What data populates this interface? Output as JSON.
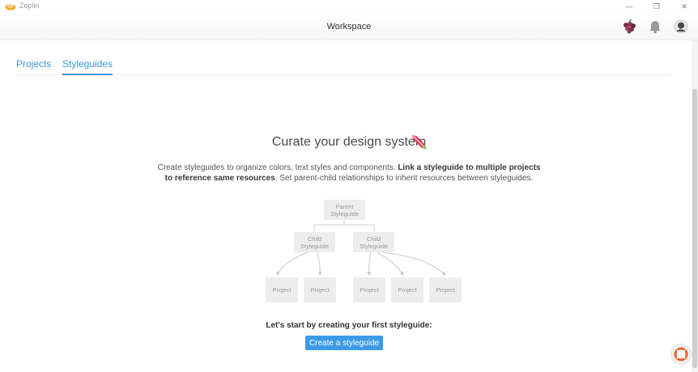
{
  "window": {
    "app_title": "Zeplin",
    "controls": {
      "minimize": "—",
      "restore": "❐",
      "close": "✕"
    }
  },
  "header": {
    "title": "Workspace",
    "icons": [
      "avatar-grapes-icon",
      "notification-bell-icon",
      "user-avatar-icon"
    ]
  },
  "tabs": [
    {
      "label": "Projects",
      "active": false
    },
    {
      "label": "Styleguides",
      "active": true
    }
  ],
  "main": {
    "heading": "Curate your design system",
    "desc_part1": "Create styleguides to organize colors, text styles and components. ",
    "desc_bold": "Link a styleguide to multiple projects to reference same resources",
    "desc_part2": ". Set parent-child relationships to inherit resources between styleguides.",
    "diagram": {
      "parent": [
        "Parent",
        "Styleguide"
      ],
      "child_left": [
        "Child",
        "Styleguide"
      ],
      "child_right": [
        "Child",
        "Styleguide"
      ],
      "project_label": "Project"
    },
    "cta_text": "Let's start by creating your first styleguide:",
    "cta_button": "Create a styleguide"
  },
  "colors": {
    "accent": "#3c96d8",
    "button": "#3c9be8",
    "node_bg": "#ededed"
  }
}
